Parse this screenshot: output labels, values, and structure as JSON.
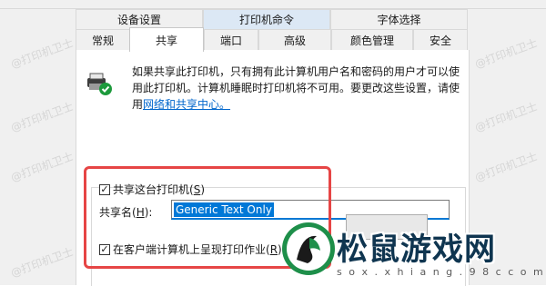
{
  "tabs_row1": [
    {
      "label": "设备设置"
    },
    {
      "label": "打印机命令"
    },
    {
      "label": "字体选择"
    }
  ],
  "tabs_row2": [
    {
      "label": "常规"
    },
    {
      "label": "共享"
    },
    {
      "label": "端口"
    },
    {
      "label": "高级"
    },
    {
      "label": "颜色管理"
    },
    {
      "label": "安全"
    }
  ],
  "active_tab": "共享",
  "info": {
    "line1": "如果共享此打印机，只有拥有此计算机用户名和密码的用户才可以使",
    "line2": "用此打印机。计算机睡眠时打印机将不可用。要更改这些设置，请使",
    "line3_prefix": "用",
    "link": "网络和共享中心。"
  },
  "share_checkbox": {
    "label_prefix": "共享这台打印机(",
    "label_key": "S",
    "label_suffix": ")",
    "checked": true
  },
  "share_name": {
    "label_prefix": "共享名(",
    "label_key": "H",
    "label_suffix": "):",
    "value": "Generic  Text Only"
  },
  "render_checkbox": {
    "label_prefix": "在客户端计算机上呈现打印作业(",
    "label_key": "R",
    "label_suffix": ")",
    "checked": true
  },
  "watermark": "@打印机卫士",
  "logo": {
    "title": "松鼠游戏网",
    "subtitle": "s o x . x h i a n g . 9 8 c c o m"
  },
  "colors": {
    "accent": "#0078d7",
    "highlight_border": "#e64545",
    "link": "#0066cc"
  }
}
